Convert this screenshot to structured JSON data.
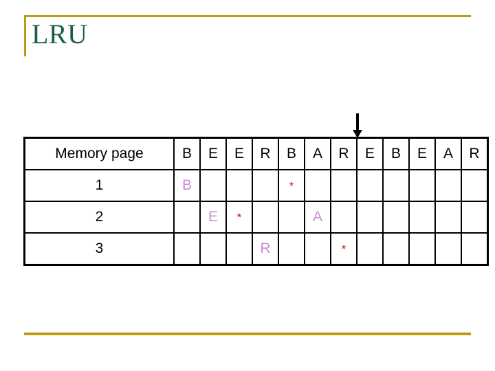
{
  "slide": {
    "title": "LRU",
    "accent_color": "#bf9a16",
    "title_color": "#1a6141"
  },
  "arrow": {
    "name": "next-reference-arrow",
    "points_to_column_index": 7,
    "direction": "down"
  },
  "table": {
    "row_label_header": "Memory page",
    "reference_string": [
      "B",
      "E",
      "E",
      "R",
      "B",
      "A",
      "R",
      "E",
      "B",
      "E",
      "A",
      "R"
    ],
    "row_labels": [
      "1",
      "2",
      "3"
    ],
    "frame_color": "#c98fd6",
    "star_color": "#bb2200",
    "highlight_color": "#ffff99",
    "rows": [
      {
        "label": "1",
        "cells": [
          {
            "text": "B",
            "highlight": false,
            "star": false
          },
          {
            "text": "",
            "highlight": false,
            "star": false
          },
          {
            "text": "",
            "highlight": false,
            "star": false
          },
          {
            "text": "",
            "highlight": false,
            "star": false
          },
          {
            "text": "*",
            "highlight": true,
            "star": true
          },
          {
            "text": "",
            "highlight": true,
            "star": false
          },
          {
            "text": "",
            "highlight": true,
            "star": false
          },
          {
            "text": "",
            "highlight": false,
            "star": false
          },
          {
            "text": "",
            "highlight": false,
            "star": false
          },
          {
            "text": "",
            "highlight": false,
            "star": false
          },
          {
            "text": "",
            "highlight": false,
            "star": false
          },
          {
            "text": "",
            "highlight": false,
            "star": false
          }
        ]
      },
      {
        "label": "2",
        "cells": [
          {
            "text": "",
            "highlight": false,
            "star": false
          },
          {
            "text": "E",
            "highlight": false,
            "star": false
          },
          {
            "text": "*",
            "highlight": false,
            "star": true
          },
          {
            "text": "",
            "highlight": false,
            "star": false
          },
          {
            "text": "",
            "highlight": false,
            "star": false
          },
          {
            "text": "A",
            "highlight": true,
            "star": false
          },
          {
            "text": "",
            "highlight": true,
            "star": false
          },
          {
            "text": "",
            "highlight": false,
            "star": false
          },
          {
            "text": "",
            "highlight": false,
            "star": false
          },
          {
            "text": "",
            "highlight": false,
            "star": false
          },
          {
            "text": "",
            "highlight": false,
            "star": false
          },
          {
            "text": "",
            "highlight": false,
            "star": false
          }
        ]
      },
      {
        "label": "3",
        "cells": [
          {
            "text": "",
            "highlight": false,
            "star": false
          },
          {
            "text": "",
            "highlight": false,
            "star": false
          },
          {
            "text": "",
            "highlight": false,
            "star": false
          },
          {
            "text": "R",
            "highlight": false,
            "star": false
          },
          {
            "text": "",
            "highlight": false,
            "star": false
          },
          {
            "text": "",
            "highlight": false,
            "star": false
          },
          {
            "text": "*",
            "highlight": true,
            "star": true
          },
          {
            "text": "",
            "highlight": false,
            "star": false
          },
          {
            "text": "",
            "highlight": false,
            "star": false
          },
          {
            "text": "",
            "highlight": false,
            "star": false
          },
          {
            "text": "",
            "highlight": false,
            "star": false
          },
          {
            "text": "",
            "highlight": false,
            "star": false
          }
        ]
      }
    ]
  }
}
